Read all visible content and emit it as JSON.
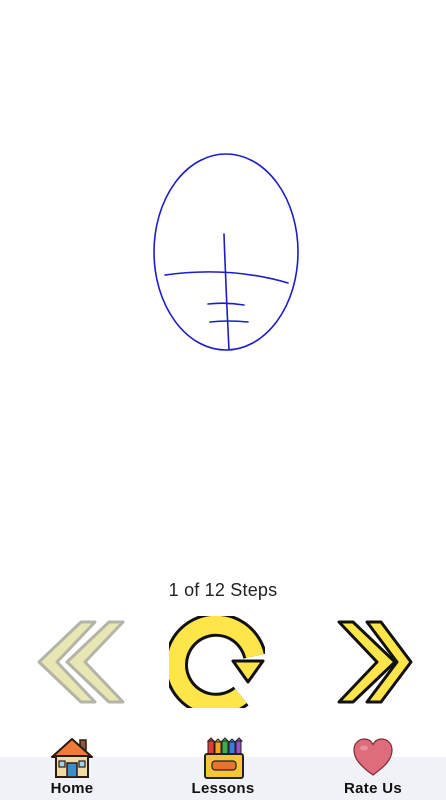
{
  "drawing": {
    "stroke_color": "#1c1cc8"
  },
  "step_counter": "1 of 12 Steps",
  "controls": {
    "prev_icon": "double-chevron-left-icon",
    "replay_icon": "replay-icon",
    "next_icon": "double-chevron-right-icon",
    "prev_state": "disabled",
    "prev_color": "#e8e6b2",
    "active_color": "#fde54a"
  },
  "nav": {
    "items": [
      {
        "label": "Home",
        "icon": "house-icon"
      },
      {
        "label": "Lessons",
        "icon": "crayon-box-icon"
      },
      {
        "label": "Rate Us",
        "icon": "heart-icon"
      }
    ]
  }
}
